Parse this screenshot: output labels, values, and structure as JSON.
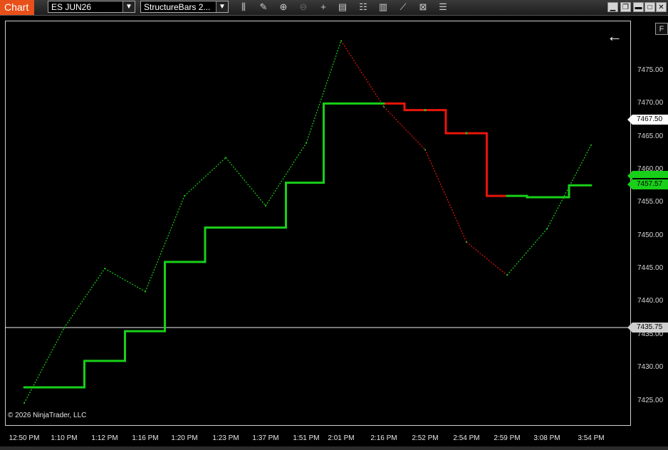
{
  "window": {
    "tab_label": "Chart"
  },
  "toolbar": {
    "instrument": "ES JUN26",
    "bar_type": "StructureBars 2...",
    "icons": [
      "bar-type-icon",
      "draw-icon",
      "zoom-in-icon",
      "zoom-out-icon",
      "crosshair-icon",
      "data-box-icon",
      "properties-icon",
      "indicators-icon",
      "strategies-icon",
      "templates-icon",
      "more-icon"
    ],
    "f_button": "F"
  },
  "chart": {
    "copyright": "© 2026 NinjaTrader, LLC",
    "back_arrow": "←",
    "colors": {
      "up": "#18d018",
      "down": "#e8150b",
      "background": "#000000"
    }
  },
  "chart_data": {
    "type": "line",
    "x": [
      "12:50 PM",
      "1:10 PM",
      "1:12 PM",
      "1:16 PM",
      "1:20 PM",
      "1:23 PM",
      "1:37 PM",
      "1:51 PM",
      "2:01 PM",
      "2:16 PM",
      "2:52 PM",
      "2:54 PM",
      "2:59 PM",
      "3:08 PM",
      "3:54 PM"
    ],
    "y_ticks": [
      "7475.00",
      "7470.00",
      "7465.00",
      "7460.00",
      "7455.00",
      "7450.00",
      "7445.00",
      "7440.00",
      "7435.00",
      "7430.00",
      "7425.00"
    ],
    "ylim": [
      7422.5,
      7481.5
    ],
    "series": [
      {
        "values": [
          7424.6,
          7436,
          7445,
          7441.5,
          7456,
          7461.8,
          7454.5,
          7464,
          7479.5,
          7469.5,
          7463,
          7449,
          7444,
          7451,
          7463.7
        ]
      },
      {
        "values": [
          7427,
          7427,
          7431,
          7435.5,
          7446,
          7451.2,
          7451.2,
          7458,
          7470,
          7470,
          7469,
          7465.5,
          7456,
          7455.8,
          7457.6
        ]
      }
    ],
    "price_markers": {
      "last": "7467.50",
      "level": "7435.75",
      "current": "7457.57"
    }
  }
}
